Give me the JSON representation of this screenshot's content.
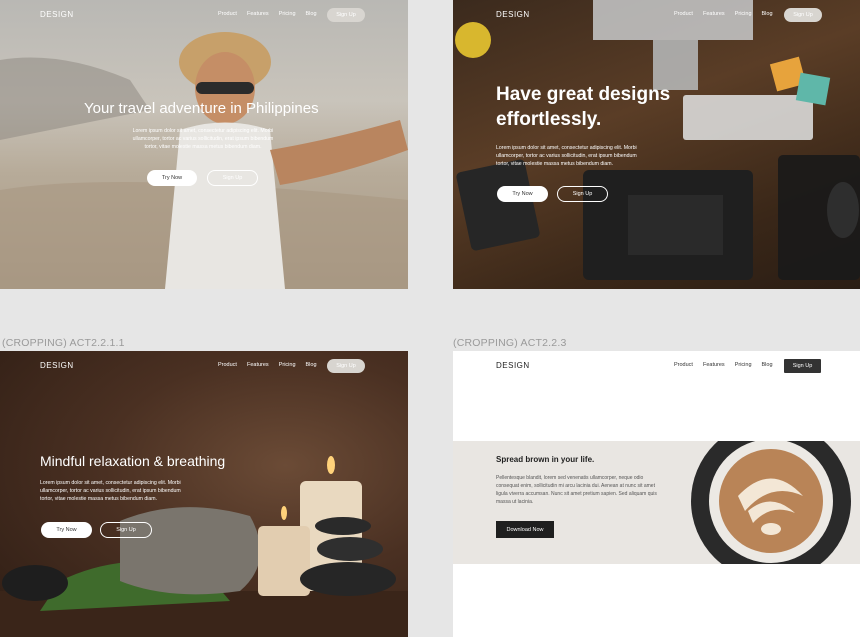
{
  "nav": {
    "logo": "DESIGN",
    "links": [
      "Product",
      "Features",
      "Pricing",
      "Blog"
    ],
    "signup": "Sign Up"
  },
  "panel1": {
    "title": "Your travel adventure in Philippines",
    "body": "Lorem ipsum dolor sit amet, consectetur adipiscing elit. Morbi ullamcorper, tortor ac varius sollicitudin, erat ipsum bibendum tortor, vitae molestie massa metus bibendum diam.",
    "try_now": "Try Now",
    "sign_up": "Sign Up"
  },
  "panel2": {
    "title_line1": "Have great designs",
    "title_line2": "effortlessly.",
    "body": "Lorem ipsum dolor sit amet, consectetur adipiscing elit. Morbi ullamcorper, tortor ac varius sollicitudin, erat ipsum bibendum tortor, vitae molestie massa metus bibendum diam.",
    "try_now": "Try Now",
    "sign_up": "Sign Up"
  },
  "panel3": {
    "caption": "(CROPPING) ACT2.2.1.1",
    "title": "Mindful relaxation & breathing",
    "body": "Lorem ipsum dolor sit amet, consectetur adipiscing elit. Morbi ullamcorper, tortor ac varius sollicitudin, erat ipsum bibendum tortor, vitae molestie massa metus bibendum diam.",
    "try_now": "Try Now",
    "sign_up": "Sign Up"
  },
  "panel4": {
    "caption": "(CROPPING) ACT2.2.3",
    "title": "Spread brown in your life.",
    "body": "Pellentesque blandit, lorem sed venenatis ullamcorper, neque odio consequat enim, sollicitudin mi arcu lacinia dui. Aenean at nunc sit amet ligula viverra accumsan. Nunc sit amet pretium sapien. Sed aliquam quis massa ut lacinia.",
    "download": "Download Now"
  },
  "colors": {
    "dark_button": "#1f1f1f",
    "pill": "#d8d5d0",
    "coffee_band": "#e9e6e2"
  }
}
